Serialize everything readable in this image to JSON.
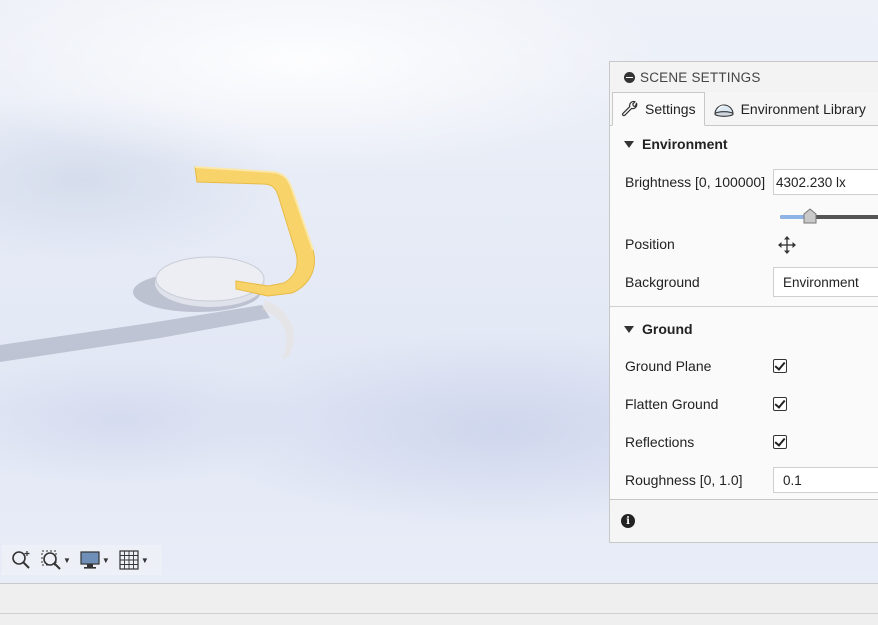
{
  "panel": {
    "title": "SCENE SETTINGS",
    "tabs": [
      {
        "label": "Settings",
        "icon": "wrench-icon",
        "active": true
      },
      {
        "label": "Environment Library",
        "icon": "environment-dome-icon",
        "active": false
      }
    ],
    "environment": {
      "title": "Environment",
      "brightness_label": "Brightness [0, 100000]",
      "brightness_value": "4302.230 lx",
      "brightness_slider_fraction": 0.043,
      "position_label": "Position",
      "position_icon": "move-arrows-icon",
      "background_label": "Background",
      "background_value": "Environment"
    },
    "ground": {
      "title": "Ground",
      "ground_plane_label": "Ground Plane",
      "ground_plane_checked": true,
      "flatten_ground_label": "Flatten Ground",
      "flatten_ground_checked": true,
      "reflections_label": "Reflections",
      "reflections_checked": true,
      "roughness_label": "Roughness [0, 1.0]",
      "roughness_value": "0.1"
    },
    "footer_icon": "info-icon"
  },
  "toolbar": {
    "items": [
      "zoom-icon",
      "zoom-window-icon",
      "display-settings-icon",
      "grid-icon"
    ]
  },
  "colors": {
    "object_yellow": "#f7d36a",
    "slider_fill": "#8fb4e8"
  }
}
